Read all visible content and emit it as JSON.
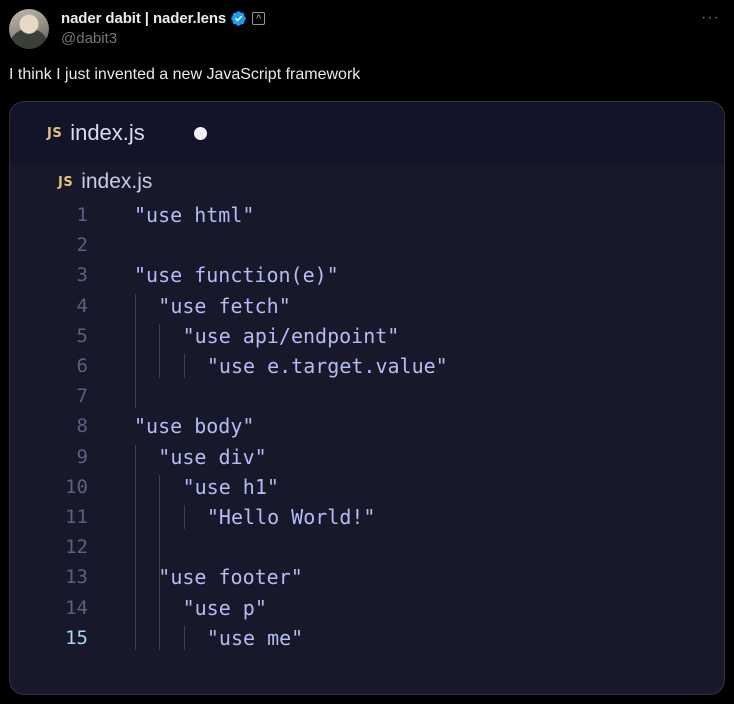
{
  "author": {
    "name": "nader dabit | nader.lens",
    "handle": "@dabit3",
    "badge_glyph": "^"
  },
  "more_glyph": "···",
  "tweet_text": "I think I just invented a new JavaScript framework",
  "editor": {
    "tab_badge": "JS",
    "tab_title": "index.js",
    "breadcrumb_badge": "JS",
    "breadcrumb_title": "index.js",
    "active_line": 15,
    "lines": [
      {
        "num": "1",
        "indent": 0,
        "code": "\"use html\""
      },
      {
        "num": "2",
        "indent": 0,
        "code": ""
      },
      {
        "num": "3",
        "indent": 0,
        "code": "\"use function(e)\""
      },
      {
        "num": "4",
        "indent": 1,
        "code": "\"use fetch\""
      },
      {
        "num": "5",
        "indent": 2,
        "code": "\"use api/endpoint\""
      },
      {
        "num": "6",
        "indent": 3,
        "code": "\"use e.target.value\""
      },
      {
        "num": "7",
        "indent": 0,
        "code": ""
      },
      {
        "num": "8",
        "indent": 0,
        "code": "\"use body\""
      },
      {
        "num": "9",
        "indent": 1,
        "code": "\"use div\""
      },
      {
        "num": "10",
        "indent": 2,
        "code": "\"use h1\""
      },
      {
        "num": "11",
        "indent": 3,
        "code": "\"Hello World!\""
      },
      {
        "num": "12",
        "indent": 0,
        "code": ""
      },
      {
        "num": "13",
        "indent": 1,
        "code": "\"use footer\""
      },
      {
        "num": "14",
        "indent": 2,
        "code": "\"use p\""
      },
      {
        "num": "15",
        "indent": 3,
        "code": "\"use me\""
      }
    ]
  },
  "colors": {
    "background": "#000000",
    "text": "#e7e9ea",
    "muted": "#71767b",
    "verified": "#1d9bf0",
    "editor_bg": "#171829",
    "code": "#b4bcf5",
    "js_badge": "#e5c07b"
  }
}
